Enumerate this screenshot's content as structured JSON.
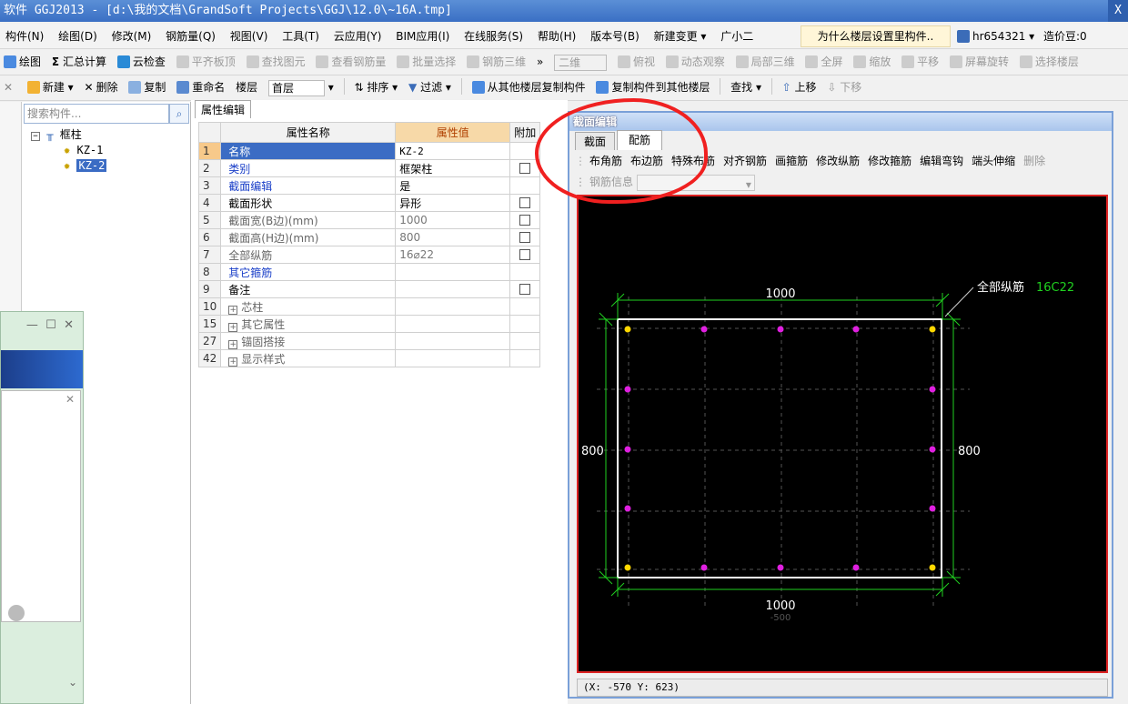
{
  "window": {
    "title": "软件 GGJ2013 - [d:\\我的文档\\GrandSoft Projects\\GGJ\\12.0\\~16A.tmp]",
    "close": "X"
  },
  "menu": [
    "构件(N)",
    "绘图(D)",
    "修改(M)",
    "钢筋量(Q)",
    "视图(V)",
    "工具(T)",
    "云应用(Y)",
    "BIM应用(I)",
    "在线服务(S)",
    "帮助(H)",
    "版本号(B)",
    "新建变更 ▾",
    "广小二"
  ],
  "ask": "为什么楼层设置里构件..",
  "user": {
    "name": "hr654321 ▾",
    "beans": "造价豆:0"
  },
  "toolbar1": [
    "绘图",
    "汇总计算",
    "云检查",
    "平齐板顶",
    "查找图元",
    "查看钢筋量",
    "批量选择",
    "钢筋三维",
    "二维",
    "俯视",
    "动态观察",
    "局部三维",
    "全屏",
    "缩放",
    "平移",
    "屏幕旋转",
    "选择楼层"
  ],
  "toolbar2": [
    "新建",
    "删除",
    "复制",
    "重命名",
    "楼层",
    "首层",
    "排序",
    "过滤",
    "从其他楼层复制构件",
    "复制构件到其他楼层",
    "查找",
    "上移",
    "下移"
  ],
  "search": {
    "placeholder": "搜索构件..."
  },
  "tree": {
    "root": "框柱",
    "items": [
      "KZ-1",
      "KZ-2"
    ]
  },
  "props": {
    "tab": "属性编辑",
    "headers": [
      "属性名称",
      "属性值",
      "附加"
    ],
    "rows": [
      {
        "no": "1",
        "name": "名称",
        "value": "KZ-2"
      },
      {
        "no": "2",
        "name": "类别",
        "value": "框架柱"
      },
      {
        "no": "3",
        "name": "截面编辑",
        "value": "是"
      },
      {
        "no": "4",
        "name": "截面形状",
        "value": "异形"
      },
      {
        "no": "5",
        "name": "截面宽(B边)(mm)",
        "value": "1000"
      },
      {
        "no": "6",
        "name": "截面高(H边)(mm)",
        "value": "800"
      },
      {
        "no": "7",
        "name": "全部纵筋",
        "value": "16⌀22"
      },
      {
        "no": "8",
        "name": "其它箍筋",
        "value": ""
      },
      {
        "no": "9",
        "name": "备注",
        "value": ""
      },
      {
        "no": "10",
        "name": "芯柱",
        "value": ""
      },
      {
        "no": "15",
        "name": "其它属性",
        "value": ""
      },
      {
        "no": "27",
        "name": "锚固搭接",
        "value": ""
      },
      {
        "no": "42",
        "name": "显示样式",
        "value": ""
      }
    ]
  },
  "section": {
    "title": "截面编辑",
    "tabs": [
      "截面",
      "配筋"
    ],
    "tools": [
      "布角筋",
      "布边筋",
      "特殊布筋",
      "对齐钢筋",
      "画箍筋",
      "修改纵筋",
      "修改箍筋",
      "编辑弯钩",
      "端头伸缩",
      "删除"
    ],
    "rebar_info_label": "钢筋信息",
    "dims": {
      "top": "1000",
      "bottom": "1000",
      "left": "800",
      "right": "800",
      "faint_bottom": "-500"
    },
    "rebar_label": "全部纵筋",
    "rebar_value": "16C22",
    "status": "(X: -570 Y: 623)"
  },
  "colors": {
    "title_bg": "#3a6fc4",
    "highlight": "#f02020",
    "rebar_corner": "#ffd700",
    "rebar_side": "#e020e0",
    "dim_line": "#20d020"
  }
}
